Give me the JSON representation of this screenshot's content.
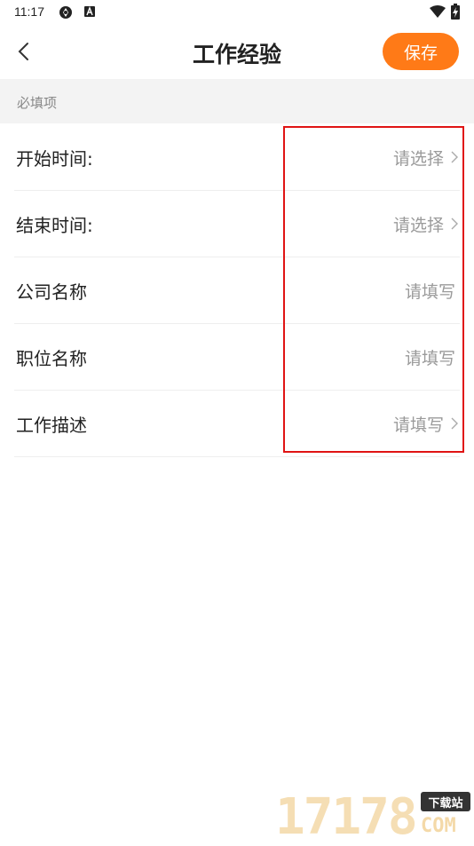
{
  "status_bar": {
    "time": "11:17"
  },
  "header": {
    "title": "工作经验",
    "save_label": "保存",
    "accent_color": "#ff7a17"
  },
  "section": {
    "label": "必填项"
  },
  "form": {
    "rows": [
      {
        "label": "开始时间:",
        "value": "请选择",
        "arrow": true
      },
      {
        "label": "结束时间:",
        "value": "请选择",
        "arrow": true
      },
      {
        "label": "公司名称",
        "value": "请填写",
        "arrow": false
      },
      {
        "label": "职位名称",
        "value": "请填写",
        "arrow": false
      },
      {
        "label": "工作描述",
        "value": "请填写",
        "arrow": true
      }
    ]
  },
  "watermark": {
    "digits": "17178",
    "tag": "下载站",
    "com": "COM"
  },
  "highlight_color": "#e01414"
}
